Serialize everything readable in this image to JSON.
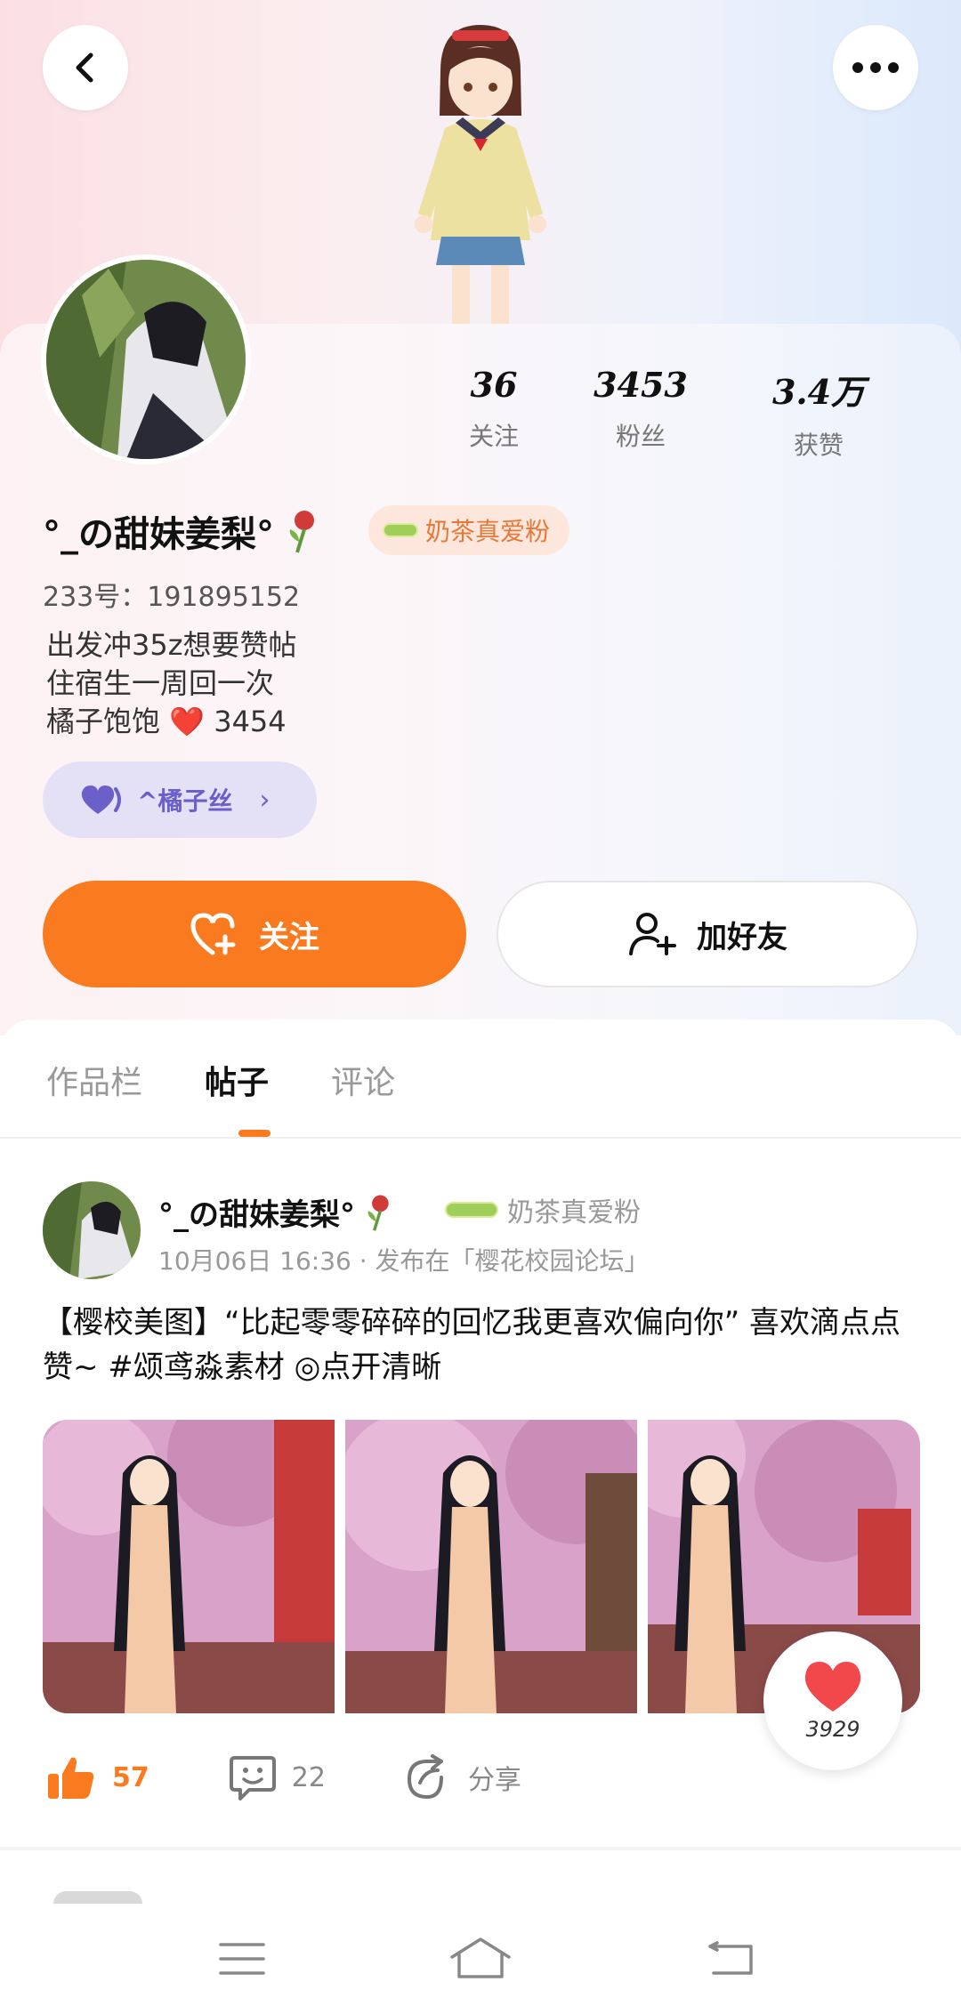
{
  "profile": {
    "stats": [
      {
        "value": "36",
        "label": "关注"
      },
      {
        "value": "3453",
        "label": "粉丝"
      },
      {
        "value": "3.4万",
        "label": "获赞"
      }
    ],
    "username": "°_の甜妹姜梨°",
    "fan_badge": "奶茶真爱粉",
    "uid": "233号：191895152",
    "bio": [
      "出发冲35z想要赞帖",
      "住宿生一周回一次",
      "橘子饱饱",
      "3454"
    ],
    "fanclub": "^橘子丝",
    "follow_label": "关注",
    "add_friend_label": "加好友"
  },
  "tabs": [
    "作品栏",
    "帖子",
    "评论"
  ],
  "post": {
    "author": "°_の甜妹姜梨°",
    "badge": "奶茶真爱粉",
    "meta": "10月06日 16:36 · 发布在「樱花校园论坛」",
    "text": "【樱校美图】“比起零零碎碎的回忆我更喜欢偏向你” 喜欢滴点点赞~ #颂鸢淼素材 ◎点开清晰",
    "likes": "57",
    "comments": "22",
    "share": "分享",
    "floating_likes": "3929"
  },
  "colors": {
    "accent": "#fa7a1f",
    "fanclub_purple": "#6b5fc9"
  }
}
